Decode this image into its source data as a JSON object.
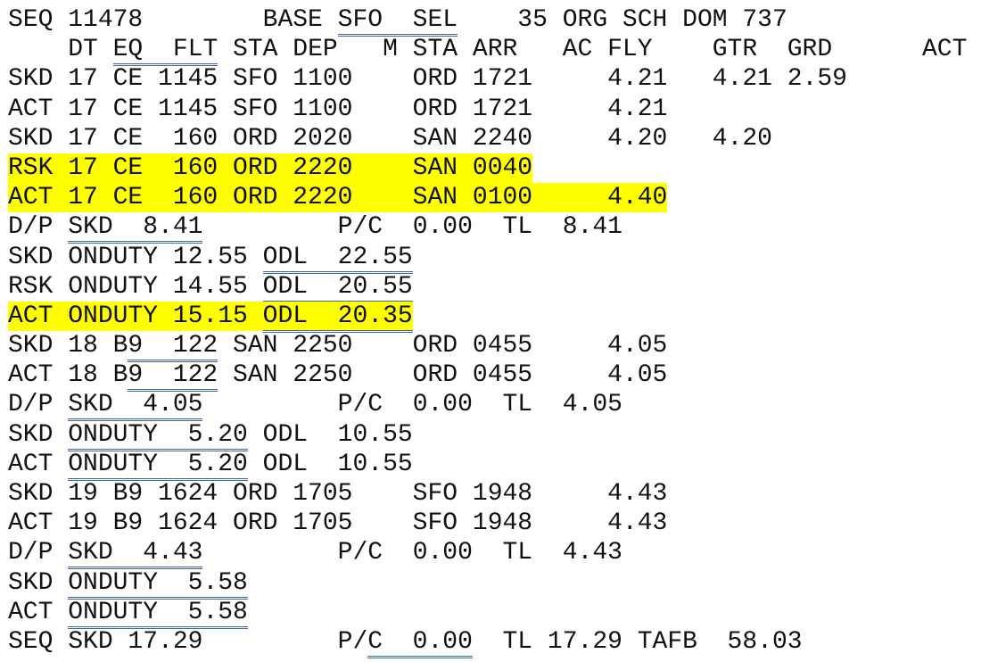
{
  "highlight_color": "#ffff00",
  "underline_color": "#3d66ad",
  "lines": [
    {
      "hl": false,
      "segs": [
        {
          "t": "SEQ 11478        BASE "
        },
        {
          "t": "SFO  SEL",
          "u": true
        },
        {
          "t": "    35 ORG SCH DOM 737"
        }
      ]
    },
    {
      "hl": false,
      "segs": [
        {
          "t": "    DT "
        },
        {
          "t": "EQ  FLT",
          "u": true
        },
        {
          "t": " STA DEP   M STA ARR   AC FLY    GTR  GRD      ACT"
        }
      ]
    },
    {
      "hl": false,
      "segs": [
        {
          "t": "SKD 17 CE 1145 SFO 1100    ORD 1721     4.21   4.21 2.59"
        }
      ]
    },
    {
      "hl": false,
      "segs": [
        {
          "t": "ACT 17 CE 1145 SFO 1100    ORD 1721     4.21"
        }
      ]
    },
    {
      "hl": false,
      "segs": [
        {
          "t": "SKD 17 CE  160 ORD 2020    SAN 2240     4.20   4.20"
        }
      ]
    },
    {
      "hl": true,
      "segs": [
        {
          "t": "RSK 17 CE  160 ORD 2220    SAN 0040"
        }
      ]
    },
    {
      "hl": true,
      "segs": [
        {
          "t": "ACT 17 CE  160 ORD 2220    SAN 0100     4.40"
        }
      ]
    },
    {
      "hl": false,
      "segs": [
        {
          "t": "D/P "
        },
        {
          "t": "SKD  8.41",
          "u": true
        },
        {
          "t": "         P/C  0.00  TL  8.41"
        }
      ]
    },
    {
      "hl": false,
      "segs": [
        {
          "t": "SKD ONDUTY 12.55 "
        },
        {
          "t": "ODL  22.55",
          "u": true
        }
      ]
    },
    {
      "hl": false,
      "segs": [
        {
          "t": "RSK ONDUTY 14.55 "
        },
        {
          "t": "ODL  20.55",
          "u": true
        }
      ]
    },
    {
      "hl": true,
      "segs": [
        {
          "t": "ACT ONDUTY 15.15 "
        },
        {
          "t": "ODL  20.35",
          "u": true
        }
      ]
    },
    {
      "hl": false,
      "segs": [
        {
          "t": "SKD 18 B"
        },
        {
          "t": "9  122",
          "u": true
        },
        {
          "t": " SAN 2250    ORD 0455     4.05"
        }
      ]
    },
    {
      "hl": false,
      "segs": [
        {
          "t": "ACT 18 B"
        },
        {
          "t": "9  122",
          "u": true
        },
        {
          "t": " SAN 2250    ORD 0455     4.05"
        }
      ]
    },
    {
      "hl": false,
      "segs": [
        {
          "t": "D/P "
        },
        {
          "t": "SKD  4.05",
          "u": true
        },
        {
          "t": "         P/C  0.00  TL  4.05"
        }
      ]
    },
    {
      "hl": false,
      "segs": [
        {
          "t": "SKD "
        },
        {
          "t": "ONDUTY  5.20",
          "u": true
        },
        {
          "t": " ODL  10.55"
        }
      ]
    },
    {
      "hl": false,
      "segs": [
        {
          "t": "ACT "
        },
        {
          "t": "ONDUTY  5.20",
          "u": true
        },
        {
          "t": " ODL  10.55"
        }
      ]
    },
    {
      "hl": false,
      "segs": [
        {
          "t": "SKD 19 B9 1624 ORD 1705    SFO 1948     4.43"
        }
      ]
    },
    {
      "hl": false,
      "segs": [
        {
          "t": "ACT 19 B9 1624 ORD 1705    SFO 1948     4.43"
        }
      ]
    },
    {
      "hl": false,
      "segs": [
        {
          "t": "D/P "
        },
        {
          "t": "SKD  4.43",
          "u": true
        },
        {
          "t": "         P/C  0.00  TL  4.43"
        }
      ]
    },
    {
      "hl": false,
      "segs": [
        {
          "t": "SKD "
        },
        {
          "t": "ONDUTY  5.58",
          "u": true
        }
      ]
    },
    {
      "hl": false,
      "segs": [
        {
          "t": "ACT "
        },
        {
          "t": "ONDUTY  5.58",
          "u": true
        }
      ]
    },
    {
      "hl": false,
      "segs": [
        {
          "t": "SEQ SKD 17.29         P/"
        },
        {
          "t": "C  0.00",
          "u": true
        },
        {
          "t": "  TL 17.29 TAFB  58.03"
        }
      ]
    }
  ]
}
